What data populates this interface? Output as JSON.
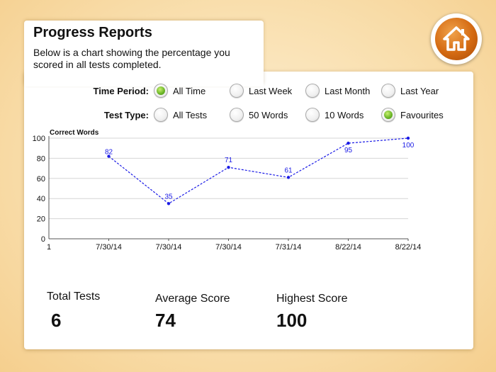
{
  "header": {
    "title": "Progress Reports",
    "description": "Below is a chart showing the percentage you scored in all tests completed."
  },
  "filters": {
    "time_period": {
      "label": "Time Period:",
      "options": [
        "All Time",
        "Last Week",
        "Last Month",
        "Last Year"
      ],
      "selected": "All Time"
    },
    "test_type": {
      "label": "Test Type:",
      "options": [
        "All Tests",
        "50 Words",
        "10 Words",
        "Favourites"
      ],
      "selected": "Favourites"
    }
  },
  "chart_data": {
    "type": "line",
    "ylabel": "Correct Words",
    "x": [
      "1",
      "7/30/14",
      "7/30/14",
      "7/30/14",
      "7/31/14",
      "8/22/14",
      "8/22/14"
    ],
    "series": [
      {
        "values": [
          82,
          35,
          71,
          61,
          95,
          100
        ]
      }
    ],
    "data_labels": [
      "82",
      "35",
      "71",
      "61",
      "95",
      "100"
    ],
    "y_ticks": [
      "0",
      "20",
      "40",
      "60",
      "80",
      "100"
    ],
    "ylim": [
      0,
      100
    ],
    "grid": true,
    "line_color": "#1a1ae6",
    "line_style": "dashed"
  },
  "stats": {
    "total_tests_label": "Total Tests",
    "total_tests_value": "6",
    "average_score_label": "Average Score",
    "average_score_value": "74",
    "highest_score_label": "Highest Score",
    "highest_score_value": "100"
  },
  "home_button": {
    "icon": "home-icon"
  }
}
